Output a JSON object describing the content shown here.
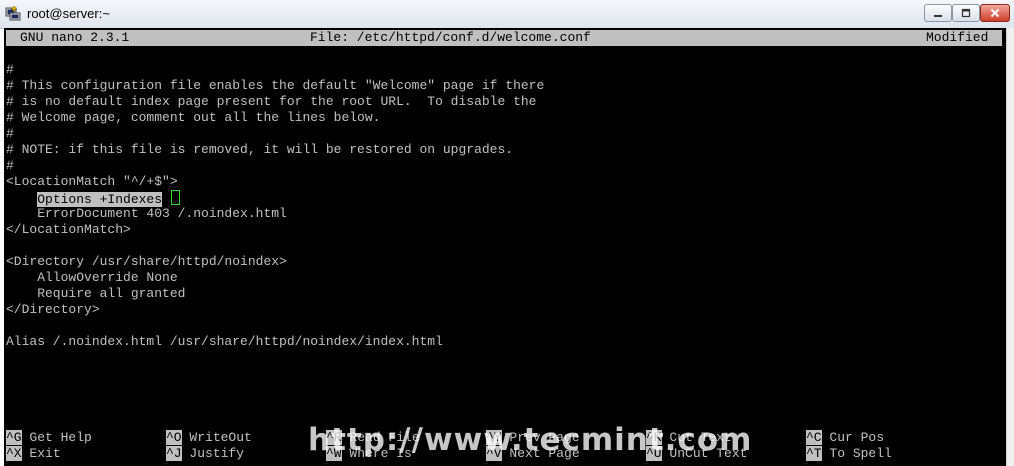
{
  "window": {
    "title": "root@server:~",
    "icons": {
      "app": "putty-terminal-icon",
      "minimize": "minimize-icon",
      "maximize": "maximize-icon",
      "close": "close-icon"
    }
  },
  "nano": {
    "version": "GNU nano 2.3.1",
    "file": "File: /etc/httpd/conf.d/welcome.conf",
    "status": "Modified"
  },
  "editor": {
    "lines": [
      "#",
      "# This configuration file enables the default \"Welcome\" page if there",
      "# is no default index page present for the root URL.  To disable the",
      "# Welcome page, comment out all the lines below.",
      "#",
      "# NOTE: if this file is removed, it will be restored on upgrades.",
      "#",
      "<LocationMatch \"^/+$\">",
      "    ",
      "    ErrorDocument 403 /.noindex.html",
      "</LocationMatch>",
      "",
      "<Directory /usr/share/httpd/noindex>",
      "    AllowOverride None",
      "    Require all granted",
      "</Directory>",
      "",
      "Alias /.noindex.html /usr/share/httpd/noindex/index.html"
    ],
    "selected_text": "Options +Indexes"
  },
  "shortcuts": [
    {
      "key": "^G",
      "label": "Get Help"
    },
    {
      "key": "^O",
      "label": "WriteOut"
    },
    {
      "key": "^R",
      "label": "Read File"
    },
    {
      "key": "^Y",
      "label": "Prev Page"
    },
    {
      "key": "^K",
      "label": "Cut Text"
    },
    {
      "key": "^C",
      "label": "Cur Pos"
    },
    {
      "key": "^X",
      "label": "Exit"
    },
    {
      "key": "^J",
      "label": "Justify"
    },
    {
      "key": "^W",
      "label": "Where Is"
    },
    {
      "key": "^V",
      "label": "Next Page"
    },
    {
      "key": "^U",
      "label": "UnCut Text"
    },
    {
      "key": "^T",
      "label": "To Spell"
    }
  ],
  "watermark": "http://www.tecmint.com"
}
